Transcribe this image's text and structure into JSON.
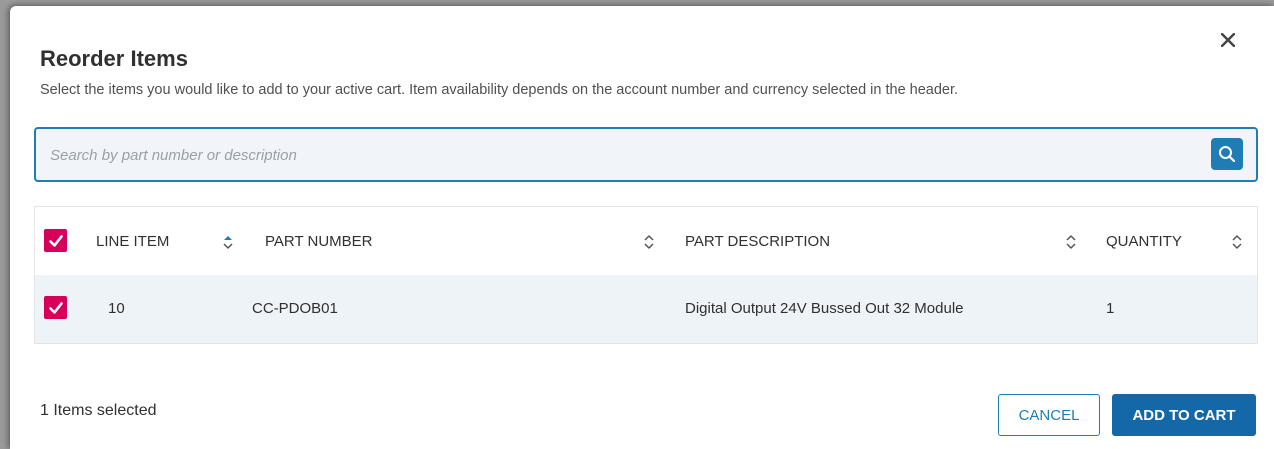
{
  "modal": {
    "title": "Reorder Items",
    "subtitle": "Select the items you would like to add to your active cart. Item availability depends on the account number and currency selected in the header."
  },
  "search": {
    "placeholder": "Search by part number or description",
    "value": ""
  },
  "table": {
    "headers": {
      "line_item": "LINE ITEM",
      "part_number": "PART NUMBER",
      "part_description": "PART DESCRIPTION",
      "quantity": "QUANTITY"
    },
    "rows": [
      {
        "line_item": "10",
        "part_number": "CC-PDOB01",
        "part_description": "Digital Output 24V Bussed Out 32 Module",
        "quantity": "1",
        "checked": true
      }
    ],
    "select_all_checked": true
  },
  "footer": {
    "selected_count": "1 Items selected",
    "cancel_label": "CANCEL",
    "add_label": "ADD TO CART"
  },
  "colors": {
    "accent": "#1f7cb5",
    "primary_button": "#1468a8",
    "checkbox": "#d6005b",
    "row_bg": "#eef3f8",
    "search_bg": "#f1f5f9"
  },
  "icons": {
    "close": "close-icon",
    "search": "search-icon",
    "check": "check-icon",
    "sort": "sort-icon"
  }
}
